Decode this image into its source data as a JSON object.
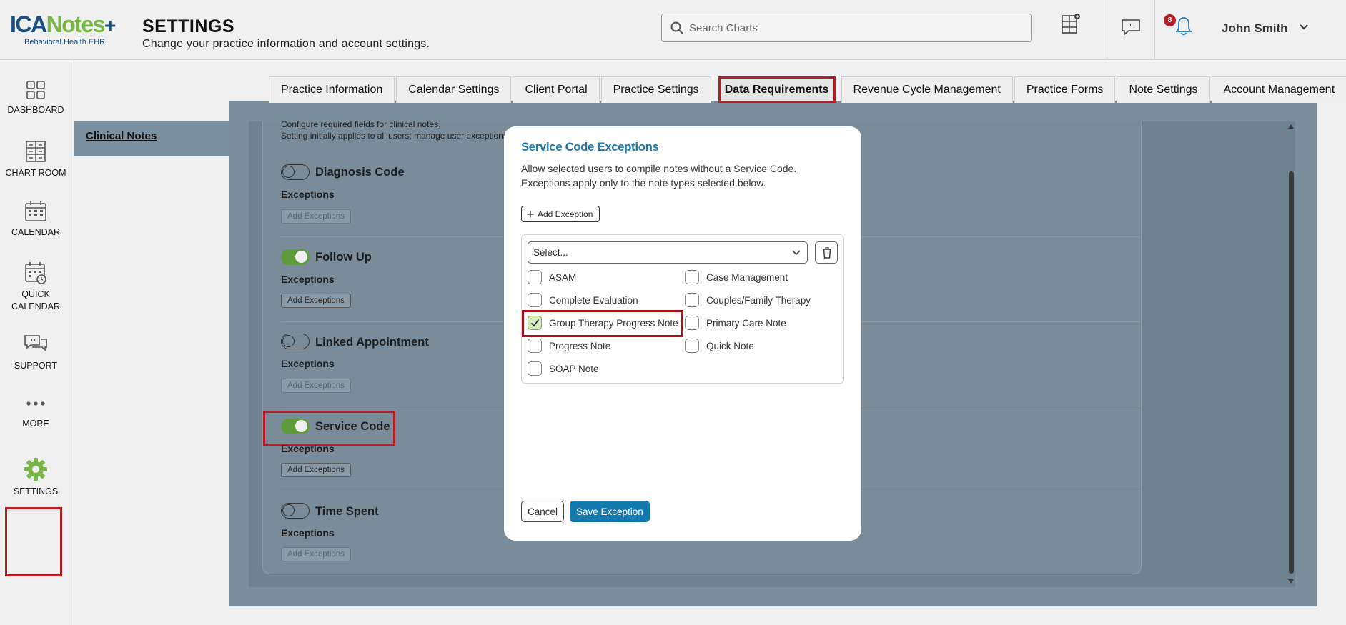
{
  "app": {
    "logo_ica": "ICA",
    "logo_notes": "Notes",
    "logo_plus": "+",
    "logo_subtitle": "Behavioral Health EHR"
  },
  "header": {
    "title": "SETTINGS",
    "subtitle": "Change your practice information and account settings.",
    "search_placeholder": "Search Charts",
    "notification_count": "8",
    "user_name": "John Smith"
  },
  "sidebar": {
    "items": [
      {
        "label": "DASHBOARD",
        "icon": "dashboard-icon"
      },
      {
        "label": "CHART ROOM",
        "icon": "chart-room-icon"
      },
      {
        "label": "CALENDAR",
        "icon": "calendar-icon"
      },
      {
        "label": "QUICK CALENDAR",
        "icon": "quick-calendar-icon"
      },
      {
        "label": "SUPPORT",
        "icon": "support-icon"
      },
      {
        "label": "MORE",
        "icon": "more-icon"
      },
      {
        "label": "SETTINGS",
        "icon": "gear-icon"
      }
    ]
  },
  "tabs": [
    {
      "label": "Practice Information"
    },
    {
      "label": "Calendar Settings"
    },
    {
      "label": "Client Portal"
    },
    {
      "label": "Practice Settings"
    },
    {
      "label": "Data Requirements",
      "active": true
    },
    {
      "label": "Revenue Cycle Management"
    },
    {
      "label": "Practice Forms"
    },
    {
      "label": "Note Settings"
    },
    {
      "label": "Account Management"
    }
  ],
  "subnav": {
    "active": "Clinical Notes"
  },
  "content": {
    "intro_line1": "Configure required fields for clinical notes.",
    "intro_line2": "Setting initially applies to all users; manage user exceptions",
    "exceptions_label": "Exceptions",
    "add_exceptions_label": "Add Exceptions",
    "fields": [
      {
        "name": "Diagnosis Code",
        "enabled": false
      },
      {
        "name": "Follow Up",
        "enabled": true
      },
      {
        "name": "Linked Appointment",
        "enabled": false
      },
      {
        "name": "Service Code",
        "enabled": true
      },
      {
        "name": "Time Spent",
        "enabled": false
      }
    ]
  },
  "modal": {
    "title": "Service Code Exceptions",
    "desc_line1": "Allow selected users to compile notes without a Service Code.",
    "desc_line2": "Exceptions apply only to the note types selected below.",
    "add_exception_label": "Add Exception",
    "select_placeholder": "Select...",
    "note_types": [
      {
        "label": "ASAM",
        "checked": false
      },
      {
        "label": "Case Management",
        "checked": false
      },
      {
        "label": "Complete Evaluation",
        "checked": false
      },
      {
        "label": "Couples/Family Therapy",
        "checked": false
      },
      {
        "label": "Group Therapy Progress Note",
        "checked": true
      },
      {
        "label": "Primary Care Note",
        "checked": false
      },
      {
        "label": "Progress Note",
        "checked": false
      },
      {
        "label": "Quick Note",
        "checked": false
      },
      {
        "label": "SOAP Note",
        "checked": false
      }
    ],
    "cancel_label": "Cancel",
    "save_label": "Save Exception"
  },
  "colors": {
    "accent_blue": "#1479ad",
    "toggle_on": "#5e9b3a",
    "highlight_red": "#b51f24"
  }
}
